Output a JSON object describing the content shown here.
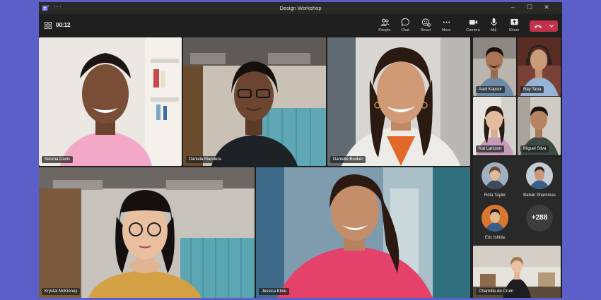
{
  "window": {
    "title": "Design Workshop"
  },
  "call": {
    "elapsed": "00:12"
  },
  "toolbar": {
    "people": "People",
    "chat": "Chat",
    "react": "React",
    "more": "More",
    "camera": "Camera",
    "mic": "Mic",
    "share": "Share"
  },
  "participants": {
    "serena": "Serena Davis",
    "daniela": "Daniela Mandera",
    "danielle": "Danielle Booker",
    "krystal": "Krystal McKinney",
    "jessica": "Jessica Kline",
    "aadi": "Aadi Kapoor",
    "ray": "Ray Tana",
    "kat": "Kat Larsson",
    "miguel": "Miguel Silva",
    "charlotte": "Charlotte de Crum"
  },
  "roster": {
    "reta": "Reta Taylor",
    "babak": "Babak Shammas",
    "eric": "Eric Ishida",
    "overflow_count": "+288"
  },
  "colors": {
    "background": "#5b5fc7",
    "leave": "#c4314b",
    "app": "#1f1f1f"
  }
}
